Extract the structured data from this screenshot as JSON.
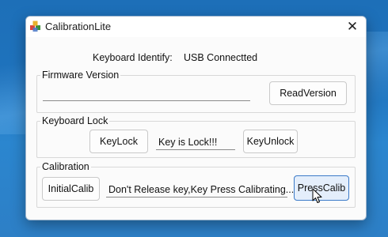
{
  "window": {
    "title": "CalibrationLite",
    "close_glyph": "✕"
  },
  "identify": {
    "label": "Keyboard Identify:",
    "value": "USB Connectted"
  },
  "firmware": {
    "group_title": "Firmware Version",
    "value": "",
    "read_button": "ReadVersion"
  },
  "keylock": {
    "group_title": "Keyboard Lock",
    "lock_button": "KeyLock",
    "status": "Key is Lock!!!",
    "unlock_button": "KeyUnlock"
  },
  "calibration": {
    "group_title": "Calibration",
    "initial_button": "InitialCalib",
    "status": "Don't Release key,Key Press Calibrating...",
    "press_button": "PressCalib"
  },
  "icons": {
    "app": "app-cubes-icon",
    "close": "close-icon",
    "cursor": "mouse-pointer-icon"
  }
}
